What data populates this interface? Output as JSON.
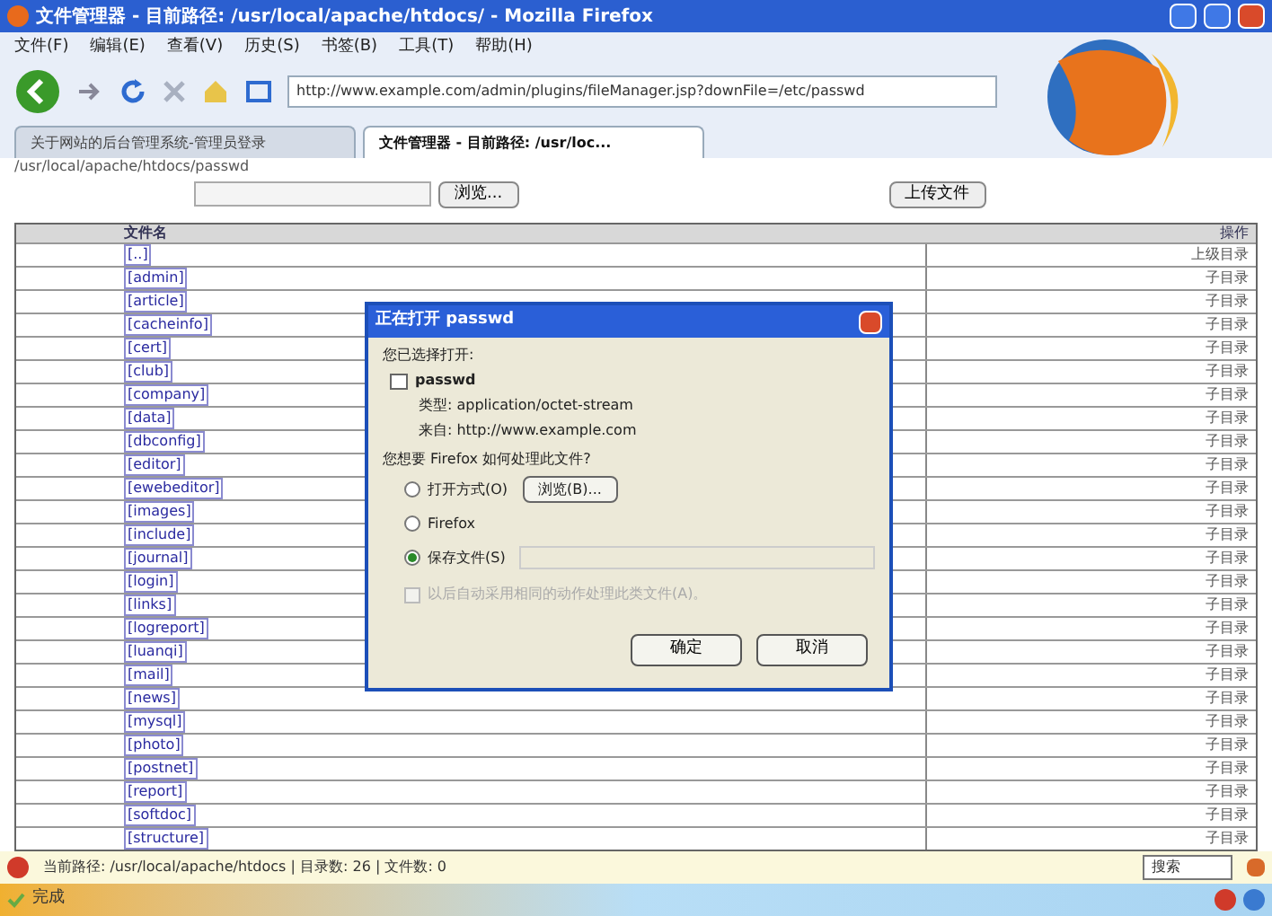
{
  "window": {
    "title": "文件管理器 - 目前路径: /usr/local/apache/htdocs/ - Mozilla Firefox"
  },
  "menu": [
    "文件(F)",
    "编辑(E)",
    "查看(V)",
    "历史(S)",
    "书签(B)",
    "工具(T)",
    "帮助(H)"
  ],
  "address": {
    "value": "http://www.example.com/admin/plugins/fileManager.jsp?downFile=/etc/passwd"
  },
  "tabs": [
    {
      "label": "关于网站的后台管理系统-管理员登录",
      "selected": false
    },
    {
      "label": "文件管理器 - 目前路径: /usr/loc...",
      "selected": true
    }
  ],
  "path": "/usr/local/apache/htdocs/passwd",
  "upload": {
    "browse_button": "浏览...",
    "upload_button": "上传文件"
  },
  "table": {
    "columns": [
      "文件名",
      "操作"
    ],
    "rows": [
      {
        "name": "[..]",
        "action": "上级目录"
      },
      {
        "name": "[admin]",
        "action": "子目录"
      },
      {
        "name": "[article]",
        "action": "子目录"
      },
      {
        "name": "[cacheinfo]",
        "action": "子目录"
      },
      {
        "name": "[cert]",
        "action": "子目录"
      },
      {
        "name": "[club]",
        "action": "子目录"
      },
      {
        "name": "[company]",
        "action": "子目录"
      },
      {
        "name": "[data]",
        "action": "子目录"
      },
      {
        "name": "[dbconfig]",
        "action": "子目录"
      },
      {
        "name": "[editor]",
        "action": "子目录"
      },
      {
        "name": "[ewebeditor]",
        "action": "子目录"
      },
      {
        "name": "[images]",
        "action": "子目录"
      },
      {
        "name": "[include]",
        "action": "子目录"
      },
      {
        "name": "[journal]",
        "action": "子目录"
      },
      {
        "name": "[login]",
        "action": "子目录"
      },
      {
        "name": "[links]",
        "action": "子目录"
      },
      {
        "name": "[logreport]",
        "action": "子目录"
      },
      {
        "name": "[luanqi]",
        "action": "子目录"
      },
      {
        "name": "[mail]",
        "action": "子目录"
      },
      {
        "name": "[news]",
        "action": "子目录"
      },
      {
        "name": "[mysql]",
        "action": "子目录"
      },
      {
        "name": "[photo]",
        "action": "子目录"
      },
      {
        "name": "[postnet]",
        "action": "子目录"
      },
      {
        "name": "[report]",
        "action": "子目录"
      },
      {
        "name": "[softdoc]",
        "action": "子目录"
      },
      {
        "name": "[structure]",
        "action": "子目录"
      }
    ]
  },
  "dialog": {
    "title": "正在打开 passwd",
    "intro": "您已选择打开:",
    "file": "passwd",
    "type": "类型: application/octet-stream",
    "source": "来自: http://www.example.com",
    "question": "您想要 Firefox 如何处理此文件?",
    "options": [
      {
        "kind": "open",
        "label": "打开方式(O)",
        "button": "浏览(B)...",
        "selected": false
      },
      {
        "kind": "app",
        "label": "Firefox",
        "selected": false
      },
      {
        "kind": "save",
        "label": "保存文件(S)",
        "selected": true
      }
    ],
    "remember": {
      "label": "以后自动采用相同的动作处理此类文件(A)。",
      "checked": false,
      "disabled": true
    },
    "buttons": [
      "确定",
      "取消"
    ]
  },
  "info_bar": {
    "text": "当前路径: /usr/local/apache/htdocs | 目录数: 26 | 文件数: 0",
    "search": "搜索"
  },
  "status": "完成"
}
